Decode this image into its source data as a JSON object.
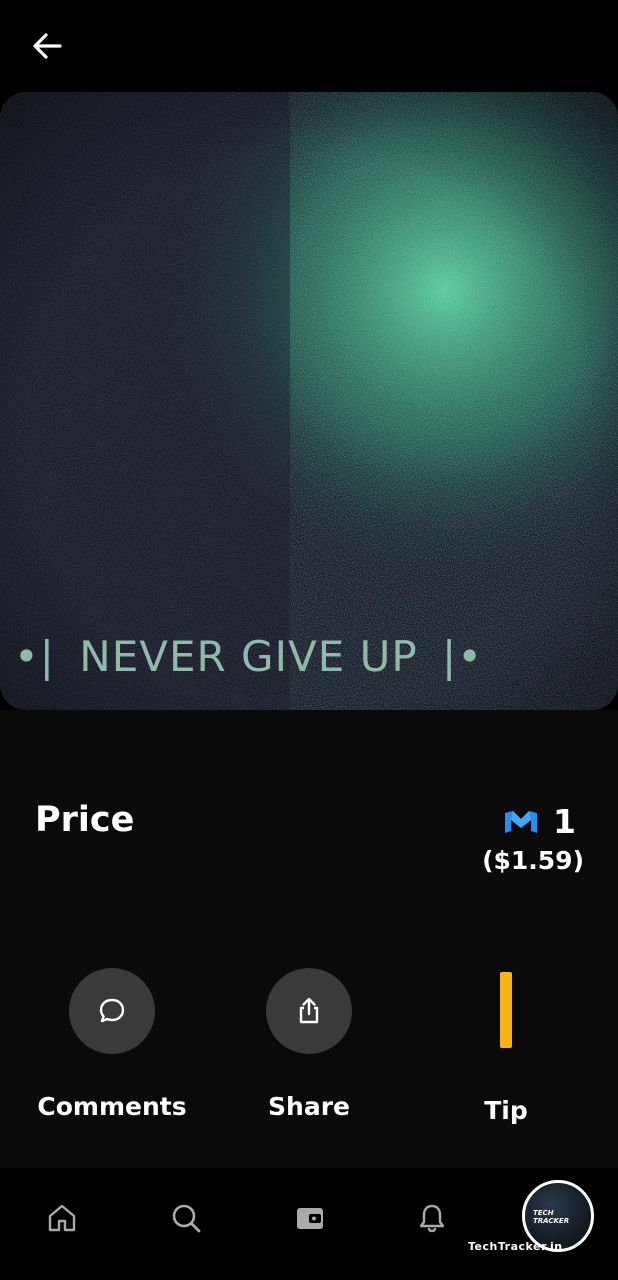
{
  "header": {
    "back_icon": "arrow-left-icon"
  },
  "artwork": {
    "text": "NEVER GIVE UP",
    "left_ornament": "•|",
    "right_ornament": "|•"
  },
  "price": {
    "label": "Price",
    "currency_icon": "polygon-matic-icon",
    "amount": "1",
    "usd": "($1.59)"
  },
  "actions": [
    {
      "label": "Comments",
      "icon": "comment-icon"
    },
    {
      "label": "Share",
      "icon": "share-icon"
    },
    {
      "label": "Tip",
      "icon": "tip-bar-icon",
      "color": "#f5b516"
    }
  ],
  "bottom_nav": {
    "items": [
      "home-icon",
      "search-icon",
      "wallet-icon",
      "bell-icon",
      "avatar"
    ],
    "avatar_text": "TECH TRACKER"
  },
  "watermark": {
    "text": "TechTracker.in"
  },
  "colors": {
    "background": "#0a0a0a",
    "action_circle": "#3a3a3a",
    "tip_accent": "#f5b516",
    "matic_blue": "#2b8af0",
    "artwork_text": "#8fb9a8"
  }
}
